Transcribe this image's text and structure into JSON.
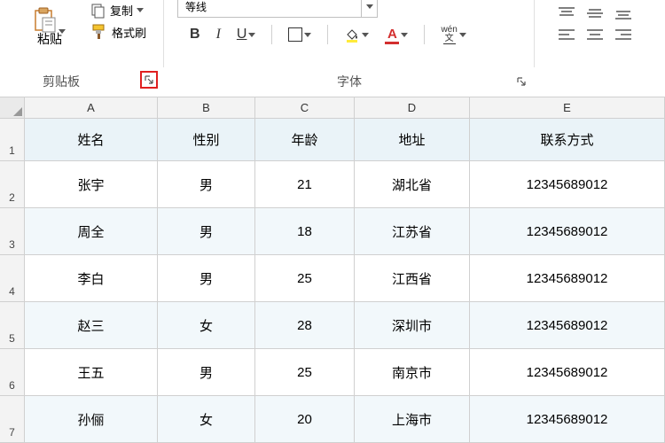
{
  "ribbon": {
    "clipboard": {
      "paste": "粘贴",
      "copy": "复制",
      "formatPainter": "格式刷",
      "groupLabel": "剪贴板"
    },
    "font": {
      "fontName": "等线",
      "bold": "B",
      "italic": "I",
      "underline": "U",
      "wen": "wén",
      "wenChar": "文",
      "fontColorLetter": "A",
      "groupLabel": "字体"
    }
  },
  "columns": [
    "A",
    "B",
    "C",
    "D",
    "E"
  ],
  "rowNumbers": [
    "1",
    "2",
    "3",
    "4",
    "5",
    "6",
    "7"
  ],
  "headers": [
    "姓名",
    "性别",
    "年龄",
    "地址",
    "联系方式"
  ],
  "rows": [
    [
      "张宇",
      "男",
      "21",
      "湖北省",
      "12345689012"
    ],
    [
      "周全",
      "男",
      "18",
      "江苏省",
      "12345689012"
    ],
    [
      "李白",
      "男",
      "25",
      "江西省",
      "12345689012"
    ],
    [
      "赵三",
      "女",
      "28",
      "深圳市",
      "12345689012"
    ],
    [
      "王五",
      "男",
      "25",
      "南京市",
      "12345689012"
    ],
    [
      "孙俪",
      "女",
      "20",
      "上海市",
      "12345689012"
    ]
  ]
}
